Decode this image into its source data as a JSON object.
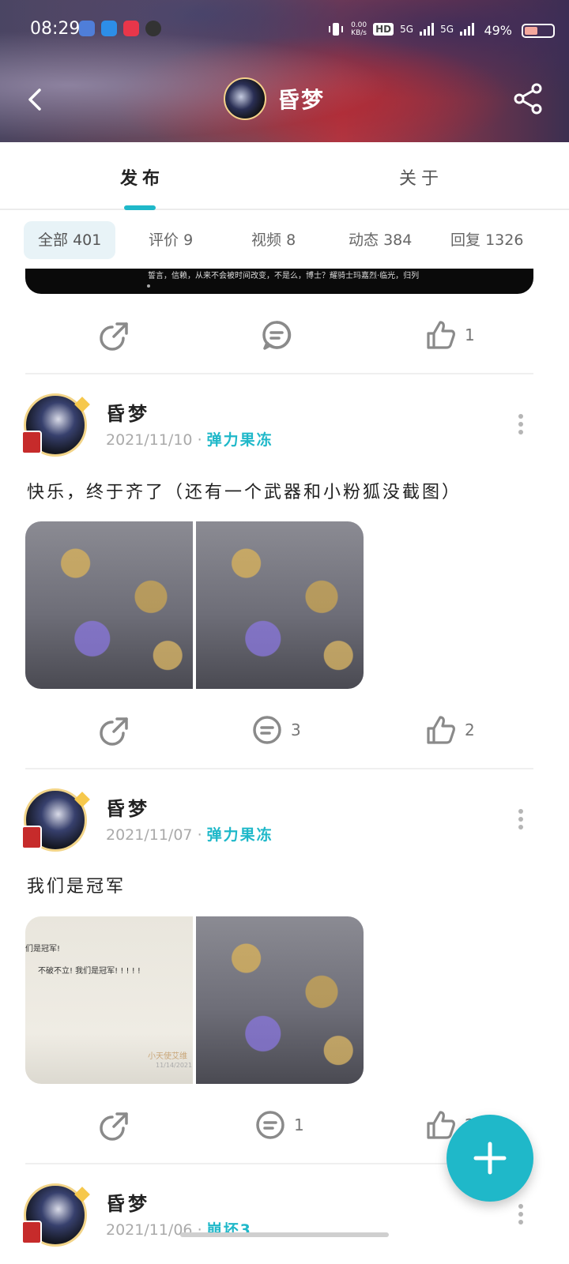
{
  "status_bar": {
    "time": "08:29",
    "net_speed_value": "0.00",
    "net_speed_unit": "KB/s",
    "hd_label": "HD",
    "net_5g_1": "5G",
    "net_5g_2": "5G",
    "battery_percent": "49%"
  },
  "header": {
    "title": "昏梦"
  },
  "tabs": [
    {
      "label": "发布",
      "active": true
    },
    {
      "label": "关于",
      "active": false
    }
  ],
  "filters": [
    {
      "label": "全部",
      "count": "401",
      "active": true
    },
    {
      "label": "评价",
      "count": "9",
      "active": false
    },
    {
      "label": "视频",
      "count": "8",
      "active": false
    },
    {
      "label": "动态",
      "count": "384",
      "active": false
    },
    {
      "label": "回复",
      "count": "1326",
      "active": false
    }
  ],
  "media_tail": {
    "caption": "誓言，信赖，从来不会被时间改变，不是么，博士？耀骑士玛嘉烈·临光，归列"
  },
  "first_actions": {
    "comments": "",
    "likes": "1"
  },
  "posts": [
    {
      "author": "昏梦",
      "date": "2021/11/10",
      "separator": "·",
      "game": "弹力果冻",
      "text": "快乐，终于齐了（还有一个武器和小粉狐没截图）",
      "images": [
        "game-screenshot-1",
        "game-screenshot-2"
      ],
      "comments": "3",
      "likes": "2"
    },
    {
      "author": "昏梦",
      "date": "2021/11/07",
      "separator": "·",
      "game": "弹力果冻",
      "text": "我们是冠军",
      "images": [
        "chat-screenshot",
        "game-screenshot-3"
      ],
      "image_texts": [
        "们是冠军!",
        "不破不立! 我们是冠军! ! ! ! !",
        "小天使艾维",
        "11/14/2021"
      ],
      "comments": "1",
      "likes": "2"
    },
    {
      "author": "昏梦",
      "date": "2021/11/06",
      "separator": "·",
      "game": "崩坏3"
    }
  ],
  "icons": {
    "back": "chevron-left-icon",
    "share": "share-icon",
    "forward": "forward-icon",
    "comment": "comment-icon",
    "like": "thumbs-up-icon",
    "more": "more-vertical-icon",
    "add": "plus-icon"
  },
  "colors": {
    "accent": "#1fb8c9",
    "chip_bg": "#e8f3f7",
    "text": "#222222",
    "muted": "#aaaaaa"
  }
}
